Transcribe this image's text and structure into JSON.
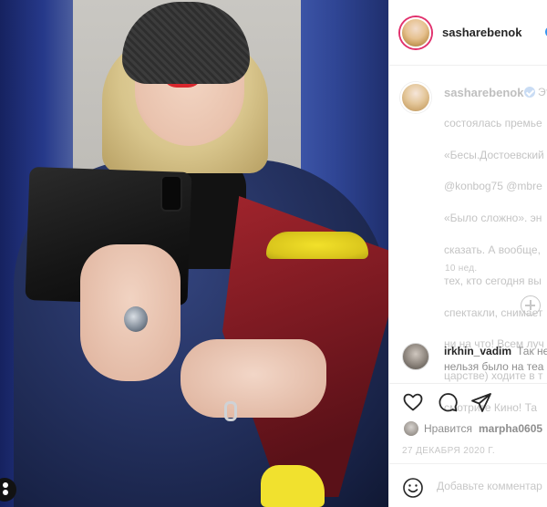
{
  "post": {
    "author": "sasharebenok",
    "header_separator": "•",
    "header_follow": "П",
    "caption_username": "sasharebenok",
    "caption_extra": "Эт",
    "caption_lines": [
      "состоялась премье",
      "«Бесы.Достоевский",
      "@konbog75 @mbre",
      "«Было сложно». эн",
      "сказать. А вообще,",
      "тех, кто сегодня вы",
      "спектакли, снимает",
      "ни на что! Всем луч",
      "царстве) ходите в т",
      "смотрите Кино! Та"
    ],
    "relative_time": "10 нед."
  },
  "comments": [
    {
      "username": "irkhin_vadim",
      "text_line1": "Так не",
      "text_line2": "нельзя было на теа"
    }
  ],
  "likes": {
    "label": "Нравится",
    "liker": "marpha0605"
  },
  "date": "27 ДЕКАБРЯ 2020 Г.",
  "comment_box": {
    "placeholder": "Добавьте комментар"
  },
  "icons": {
    "like": "heart-icon",
    "comment": "comment-icon",
    "share": "share-icon",
    "emoji": "emoji-icon",
    "add": "plus-circle-icon",
    "verified": "verified-badge-icon",
    "more": "more-options-icon"
  },
  "colors": {
    "verified": "#3897f0",
    "story_ring": "#e1306c",
    "muted_text": "#8e8e8e"
  }
}
